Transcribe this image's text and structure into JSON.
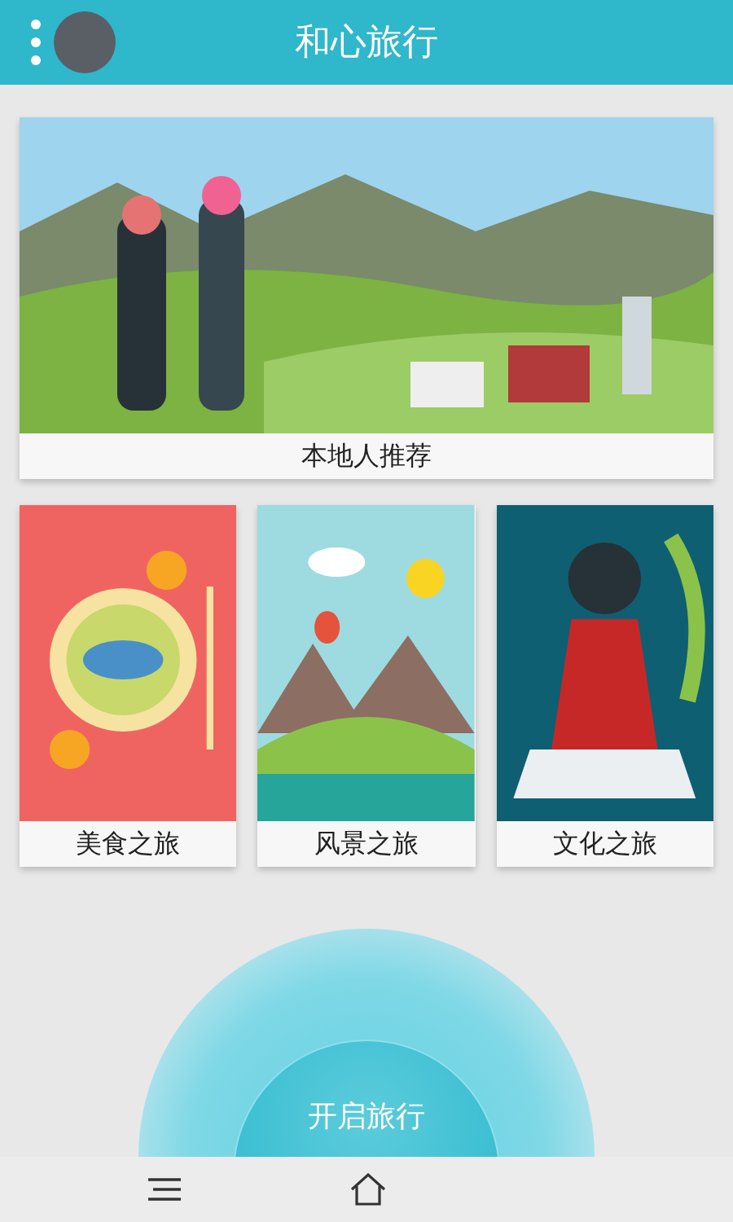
{
  "header": {
    "title": "和心旅行"
  },
  "featured": {
    "caption": "本地人推荐"
  },
  "categories": [
    {
      "caption": "美食之旅",
      "kind": "food"
    },
    {
      "caption": "风景之旅",
      "kind": "scenery"
    },
    {
      "caption": "文化之旅",
      "kind": "culture"
    }
  ],
  "start_button": {
    "label": "开启旅行"
  }
}
